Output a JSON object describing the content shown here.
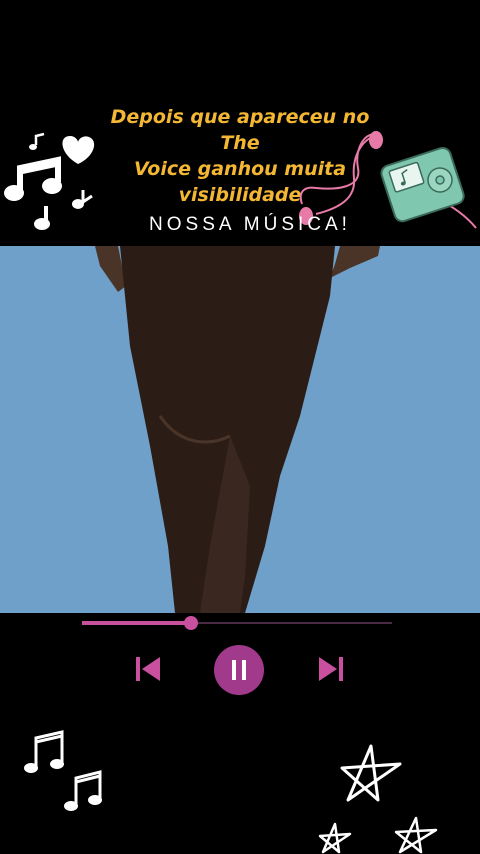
{
  "caption": {
    "line1": "Depois que apareceu no The",
    "line2": "Voice ganhou muita",
    "line3": "visibilidade"
  },
  "subtitle": "NOSSA MÚSICA!",
  "player": {
    "progress": 0.35,
    "accent": "#c9509e",
    "button_color": "#a23a8c",
    "state": "playing"
  },
  "icons": {
    "prev": "skip-previous-icon",
    "pause": "pause-icon",
    "next": "skip-next-icon"
  },
  "colors": {
    "caption": "#f4b733",
    "photo_bg": "#6fa0c9",
    "background": "#000000"
  }
}
